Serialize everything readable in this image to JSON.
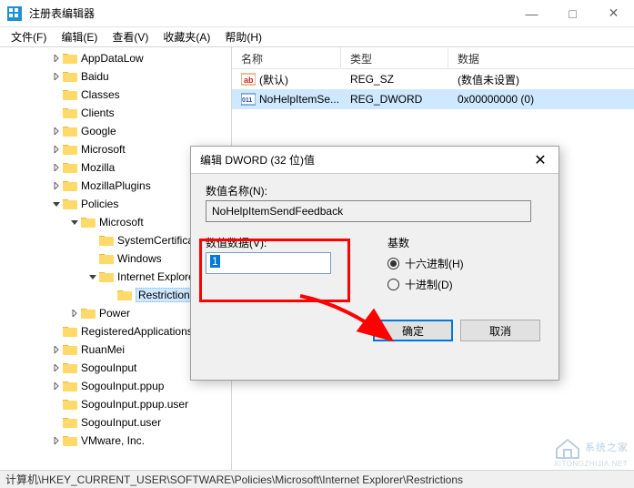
{
  "window": {
    "title": "注册表编辑器",
    "minimize": "—",
    "maximize": "□",
    "close": "✕"
  },
  "menu": {
    "file": "文件(F)",
    "edit": "编辑(E)",
    "view": "查看(V)",
    "favorites": "收藏夹(A)",
    "help": "帮助(H)"
  },
  "tree": [
    {
      "indent": 55,
      "chev": "right",
      "label": "AppDataLow"
    },
    {
      "indent": 55,
      "chev": "right",
      "label": "Baidu"
    },
    {
      "indent": 55,
      "chev": "none",
      "label": "Classes"
    },
    {
      "indent": 55,
      "chev": "none",
      "label": "Clients"
    },
    {
      "indent": 55,
      "chev": "right",
      "label": "Google"
    },
    {
      "indent": 55,
      "chev": "right",
      "label": "Microsoft"
    },
    {
      "indent": 55,
      "chev": "right",
      "label": "Mozilla"
    },
    {
      "indent": 55,
      "chev": "right",
      "label": "MozillaPlugins"
    },
    {
      "indent": 55,
      "chev": "down",
      "label": "Policies"
    },
    {
      "indent": 75,
      "chev": "down",
      "label": "Microsoft"
    },
    {
      "indent": 95,
      "chev": "none",
      "label": "SystemCertificates"
    },
    {
      "indent": 95,
      "chev": "none",
      "label": "Windows"
    },
    {
      "indent": 95,
      "chev": "down",
      "label": "Internet Explorer"
    },
    {
      "indent": 115,
      "chev": "none",
      "label": "Restrictions",
      "selected": true
    },
    {
      "indent": 75,
      "chev": "right",
      "label": "Power"
    },
    {
      "indent": 55,
      "chev": "none",
      "label": "RegisteredApplications"
    },
    {
      "indent": 55,
      "chev": "right",
      "label": "RuanMei"
    },
    {
      "indent": 55,
      "chev": "right",
      "label": "SogouInput"
    },
    {
      "indent": 55,
      "chev": "right",
      "label": "SogouInput.ppup"
    },
    {
      "indent": 55,
      "chev": "none",
      "label": "SogouInput.ppup.user"
    },
    {
      "indent": 55,
      "chev": "none",
      "label": "SogouInput.user"
    },
    {
      "indent": 55,
      "chev": "right",
      "label": "VMware, Inc."
    }
  ],
  "list": {
    "columns": {
      "name": "名称",
      "type": "类型",
      "data": "数据"
    },
    "rows": [
      {
        "icon": "ab",
        "name": "(默认)",
        "type": "REG_SZ",
        "data": "(数值未设置)"
      },
      {
        "icon": "bin",
        "name": "NoHelpItemSe...",
        "type": "REG_DWORD",
        "data": "0x00000000 (0)",
        "selected": true
      }
    ]
  },
  "statusbar": "计算机\\HKEY_CURRENT_USER\\SOFTWARE\\Policies\\Microsoft\\Internet Explorer\\Restrictions",
  "dialog": {
    "title": "编辑 DWORD (32 位)值",
    "close": "✕",
    "name_label": "数值名称(N):",
    "name_value": "NoHelpItemSendFeedback",
    "value_label": "数值数据(V):",
    "value_value": "1",
    "radix_label": "基数",
    "radix_hex": "十六进制(H)",
    "radix_dec": "十进制(D)",
    "ok": "确定",
    "cancel": "取消"
  },
  "watermark": "系统之家"
}
